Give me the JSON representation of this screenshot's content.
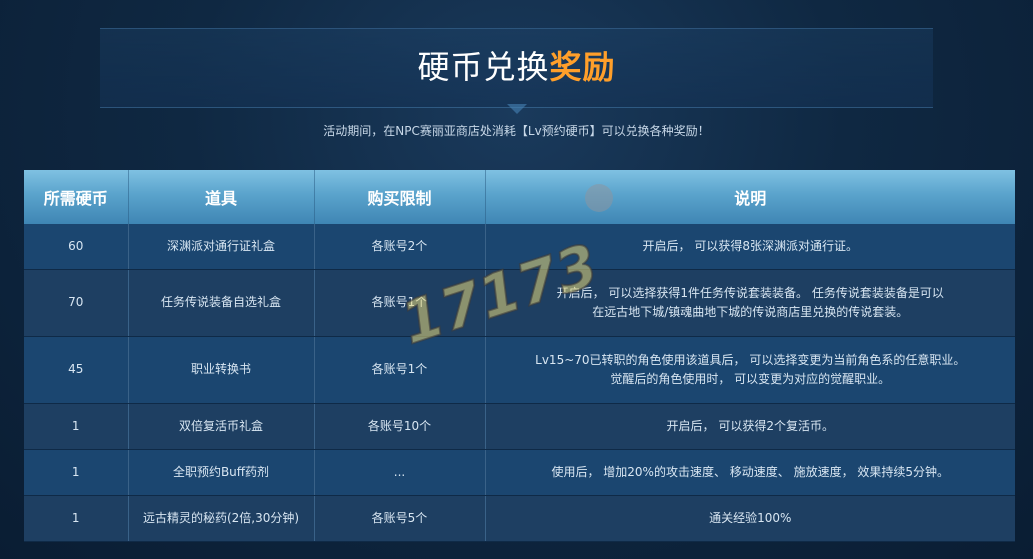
{
  "header": {
    "title_main": "硬币兑换",
    "title_accent": "奖励",
    "subtitle": "活动期间，在NPC赛丽亚商店处消耗【Lv预约硬币】可以兑换各种奖励！"
  },
  "table": {
    "columns": [
      "所需硬币",
      "道具",
      "购买限制",
      "说明"
    ],
    "rows": [
      {
        "coins": "60",
        "item": "深渊派对通行证礼盒",
        "limit": "各账号2个",
        "desc": [
          "开启后， 可以获得8张深渊派对通行证。"
        ]
      },
      {
        "coins": "70",
        "item": "任务传说装备自选礼盒",
        "limit": "各账号1个",
        "desc": [
          "开启后， 可以选择获得1件任务传说套装装备。 任务传说套装装备是可以",
          "在远古地下城/镇魂曲地下城的传说商店里兑换的传说套装。"
        ]
      },
      {
        "coins": "45",
        "item": "职业转换书",
        "limit": "各账号1个",
        "desc": [
          "Lv15~70已转职的角色使用该道具后， 可以选择变更为当前角色系的任意职业。",
          "觉醒后的角色使用时， 可以变更为对应的觉醒职业。"
        ]
      },
      {
        "coins": "1",
        "item": "双倍复活币礼盒",
        "limit": "各账号10个",
        "desc": [
          "开启后， 可以获得2个复活币。"
        ]
      },
      {
        "coins": "1",
        "item": "全职预约Buff药剂",
        "limit": "...",
        "desc": [
          "使用后， 增加20%的攻击速度、 移动速度、 施放速度， 效果持续5分钟。"
        ]
      },
      {
        "coins": "1",
        "item": "远古精灵的秘药(2倍,30分钟)",
        "limit": "各账号5个",
        "desc": [
          "通关经验100%"
        ]
      }
    ]
  },
  "watermark": {
    "text": "17173"
  },
  "colors": {
    "accent": "#ff9f2a",
    "header_bg": "#5aa3cc",
    "row_odd": "#1b4670",
    "row_even": "#1e3f62"
  }
}
